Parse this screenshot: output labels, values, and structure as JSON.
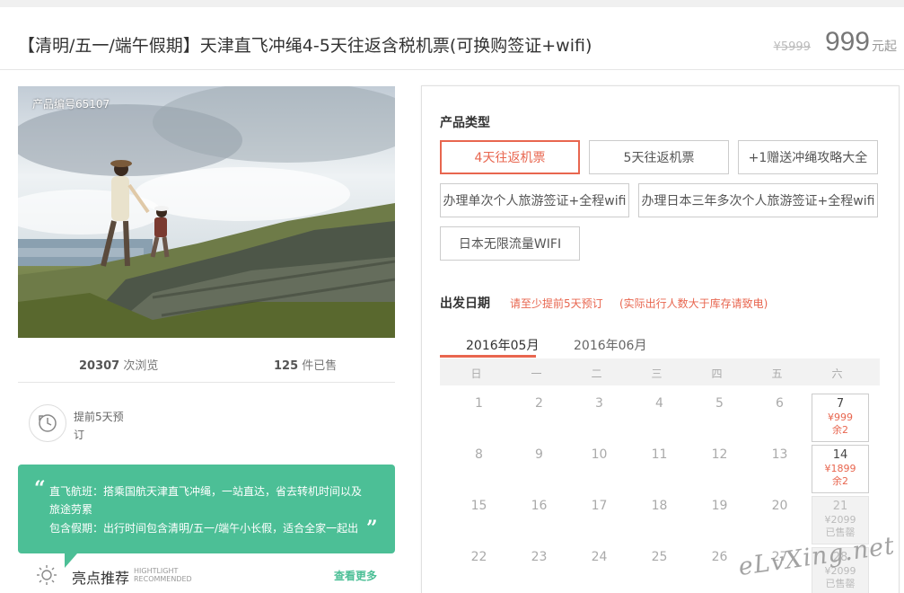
{
  "header": {
    "title": "【清明/五一/端午假期】天津直飞冲绳4-5天往返含税机票(可换购签证+wifi)",
    "original_price": "¥5999",
    "price": "999",
    "price_unit": "元起"
  },
  "gallery": {
    "product_code": "产品编号65107"
  },
  "stats": {
    "views_count": "20307",
    "views_label": "次浏览",
    "sold_count": "125",
    "sold_label": "件已售"
  },
  "advance_notice": {
    "text": "提前5天预订"
  },
  "feature_box": {
    "line1": "直飞航班：搭乘国航天津直飞冲绳，一站直达，省去转机时间以及",
    "line2": "旅途劳累",
    "line3": "包含假期：出行时间包含清明/五一/端午小长假，适合全家一起出"
  },
  "highlights": {
    "title": "亮点推荐",
    "subtitle_line1": "HIGHTLIGHT",
    "subtitle_line2": "RECOMMENDED",
    "see_more": "查看更多"
  },
  "product_type": {
    "label": "产品类型",
    "options": [
      "4天往返机票",
      "5天往返机票",
      "+1赠送冲绳攻略大全",
      "办理单次个人旅游签证+全程wifi",
      "办理日本三年多次个人旅游签证+全程wifi",
      "日本无限流量WIFI"
    ],
    "selected": "4天往返机票"
  },
  "departure": {
    "label": "出发日期",
    "hint1": "请至少提前5天预订",
    "hint2": "(实际出行人数大于库存请致电)"
  },
  "calendar": {
    "months": [
      "2016年05月",
      "2016年06月"
    ],
    "active_month": "2016年05月",
    "weekdays": [
      "日",
      "一",
      "二",
      "三",
      "四",
      "五",
      "六"
    ],
    "rows": [
      [
        "1",
        "2",
        "3",
        "4",
        "5",
        "6"
      ],
      [
        "8",
        "9",
        "10",
        "11",
        "12",
        "13"
      ],
      [
        "15",
        "16",
        "17",
        "18",
        "19",
        "20"
      ],
      [
        "22",
        "23",
        "24",
        "25",
        "26",
        "27"
      ]
    ],
    "available": [
      {
        "day": "7",
        "price": "¥999",
        "stock": "余2"
      },
      {
        "day": "14",
        "price": "¥1899",
        "stock": "余2"
      },
      {
        "day": "21",
        "price": "¥2099",
        "stock": "已售罄"
      },
      {
        "day": "28",
        "price": "¥2099",
        "stock": "已售罄"
      }
    ]
  },
  "watermark": "eLvXing.net",
  "colors": {
    "accent": "#e8664f",
    "green": "#4cbf96"
  }
}
